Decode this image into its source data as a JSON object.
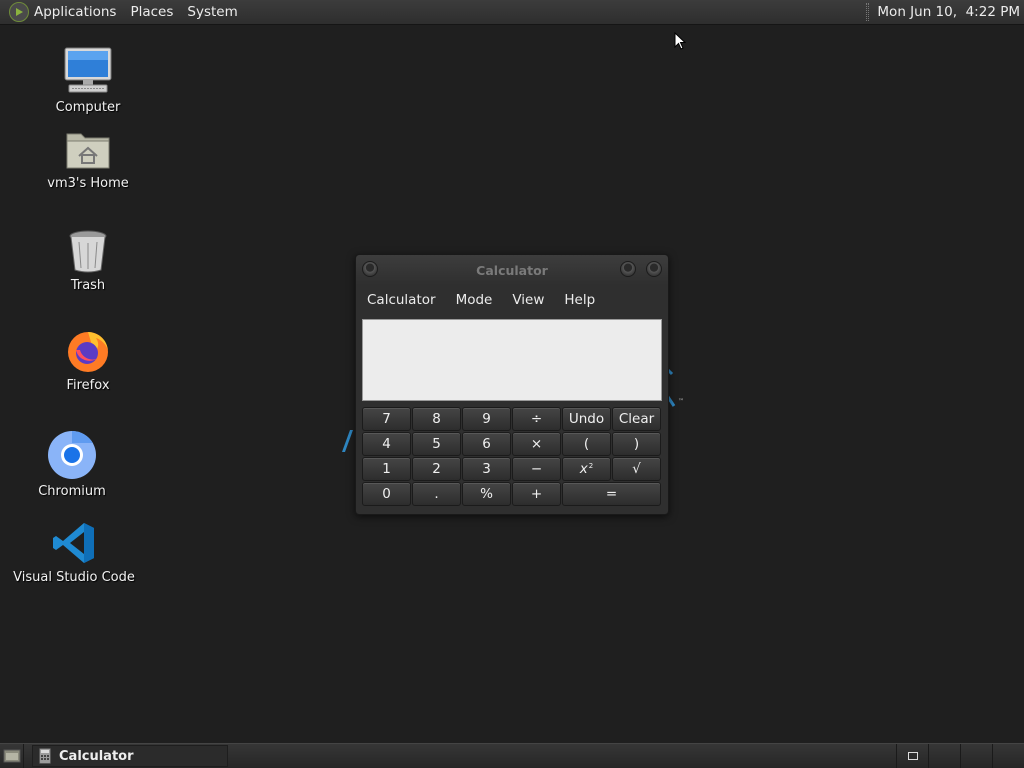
{
  "top_panel": {
    "menus": [
      "Applications",
      "Places",
      "System"
    ],
    "clock": "Mon Jun 10,  4:22 PM"
  },
  "desktop": {
    "icons": [
      {
        "label": "Computer",
        "icon": "computer-icon"
      },
      {
        "label": "vm3's Home",
        "icon": "home-folder-icon"
      },
      {
        "label": "Trash",
        "icon": "trash-icon"
      },
      {
        "label": "Firefox",
        "icon": "firefox-icon"
      },
      {
        "label": "Chromium",
        "icon": "chromium-icon"
      },
      {
        "label": "Visual Studio Code",
        "icon": "vscode-icon"
      }
    ]
  },
  "calculator": {
    "title": "Calculator",
    "menus": [
      "Calculator",
      "Mode",
      "View",
      "Help"
    ],
    "display_value": "",
    "keys": [
      [
        "7",
        "8",
        "9",
        "÷",
        "Undo",
        "Clear"
      ],
      [
        "4",
        "5",
        "6",
        "×",
        "(",
        ")"
      ],
      [
        "1",
        "2",
        "3",
        "−",
        "x²",
        "√"
      ],
      [
        "0",
        ".",
        "%",
        "+",
        "="
      ]
    ],
    "square_key": {
      "base": "x",
      "exponent": "2"
    }
  },
  "taskbar": {
    "task_label": "Calculator"
  },
  "colors": {
    "desktop_bg": "#1f1f1f",
    "panel_bg": "#333333",
    "window_bg": "#2f2f2f",
    "display_bg": "#ececec"
  }
}
